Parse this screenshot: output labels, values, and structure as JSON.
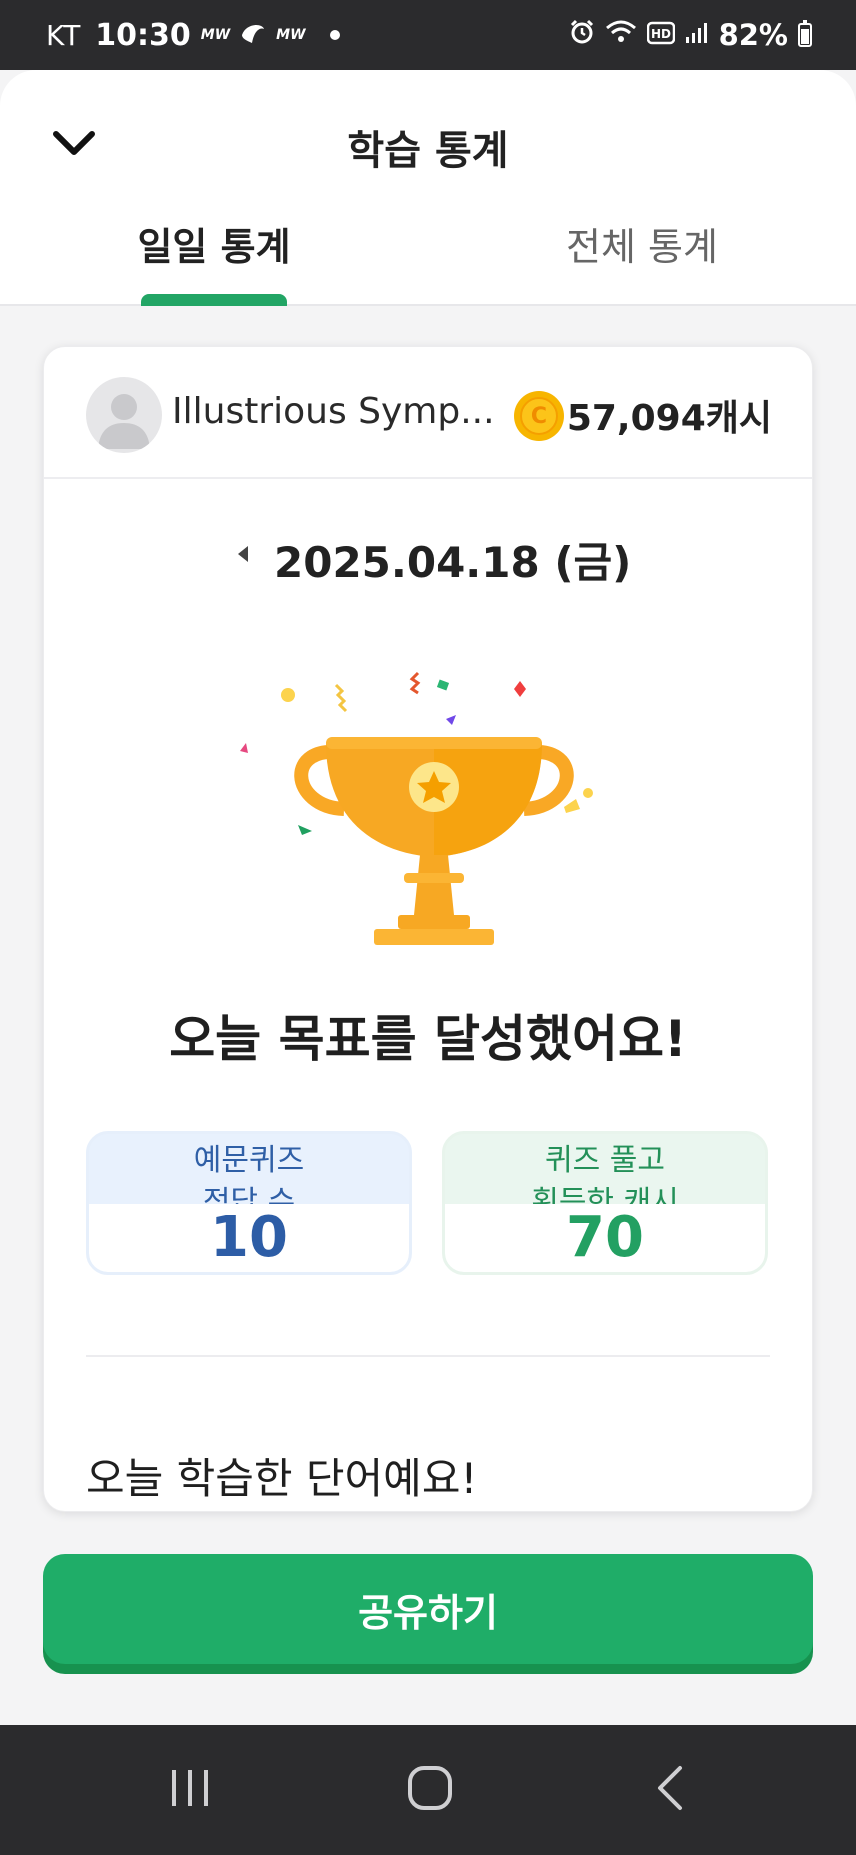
{
  "status_bar": {
    "carrier": "KT",
    "time": "10:30",
    "indicator_1": "MW",
    "indicator_2": "MW",
    "battery": "82%",
    "icons": [
      "alarm-icon",
      "wifi-icon",
      "hd-icon",
      "signal-icon",
      "battery-icon"
    ]
  },
  "header": {
    "title": "학습 통계",
    "collapse_icon": "chevron-down-icon"
  },
  "tabs": [
    {
      "label": "일일 통계",
      "active": true
    },
    {
      "label": "전체 통계",
      "active": false
    }
  ],
  "profile": {
    "username": "Illustrious Symp...",
    "cash": "57,094캐시",
    "coin_glyph": "C"
  },
  "date": {
    "text": "2025.04.18 (금)",
    "prev_icon": "triangle-left-icon"
  },
  "goal_message": "오늘 목표를 달성했어요!",
  "stats": [
    {
      "label": "예문퀴즈\n정답 수",
      "value": "10"
    },
    {
      "label": "퀴즈 풀고\n획득한 캐시",
      "value": "70"
    }
  ],
  "learned_words_title": "오늘 학습한 단어예요!",
  "share_button": "공유하기",
  "nav_bar": [
    "recent-apps-icon",
    "home-icon",
    "back-icon"
  ],
  "colors": {
    "accent_green": "#1fad68",
    "quiz_blue": "#2d5da6",
    "cash_green": "#23a062",
    "trophy_gold": "#f9a825"
  }
}
